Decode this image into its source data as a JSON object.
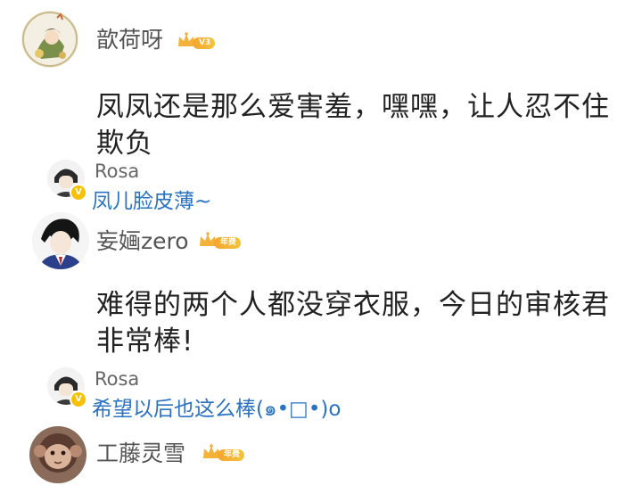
{
  "comments": [
    {
      "username": "歆荷呀",
      "badge": "V3",
      "avatar_icon": "cartoon-girl-avatar",
      "text": "凤凤还是那么爱害羞，嘿嘿，让人忍不住欺负",
      "reply": {
        "username": "Rosa",
        "text": "凤儿脸皮薄~"
      }
    },
    {
      "username": "妄婳zero",
      "badge": "年费",
      "avatar_icon": "anime-boy-avatar",
      "text": "难得的两个人都没穿衣服，今日的审核君非常棒!",
      "reply": {
        "username": "Rosa",
        "text": "希望以后也这么棒(๑•□•)о"
      }
    },
    {
      "username": "工藤灵雪",
      "badge": "年费",
      "avatar_icon": "monkey-avatar"
    }
  ],
  "colors": {
    "reply_text": "#2a72c2",
    "badge_gold": "#f3b23a",
    "username": "#555555"
  }
}
